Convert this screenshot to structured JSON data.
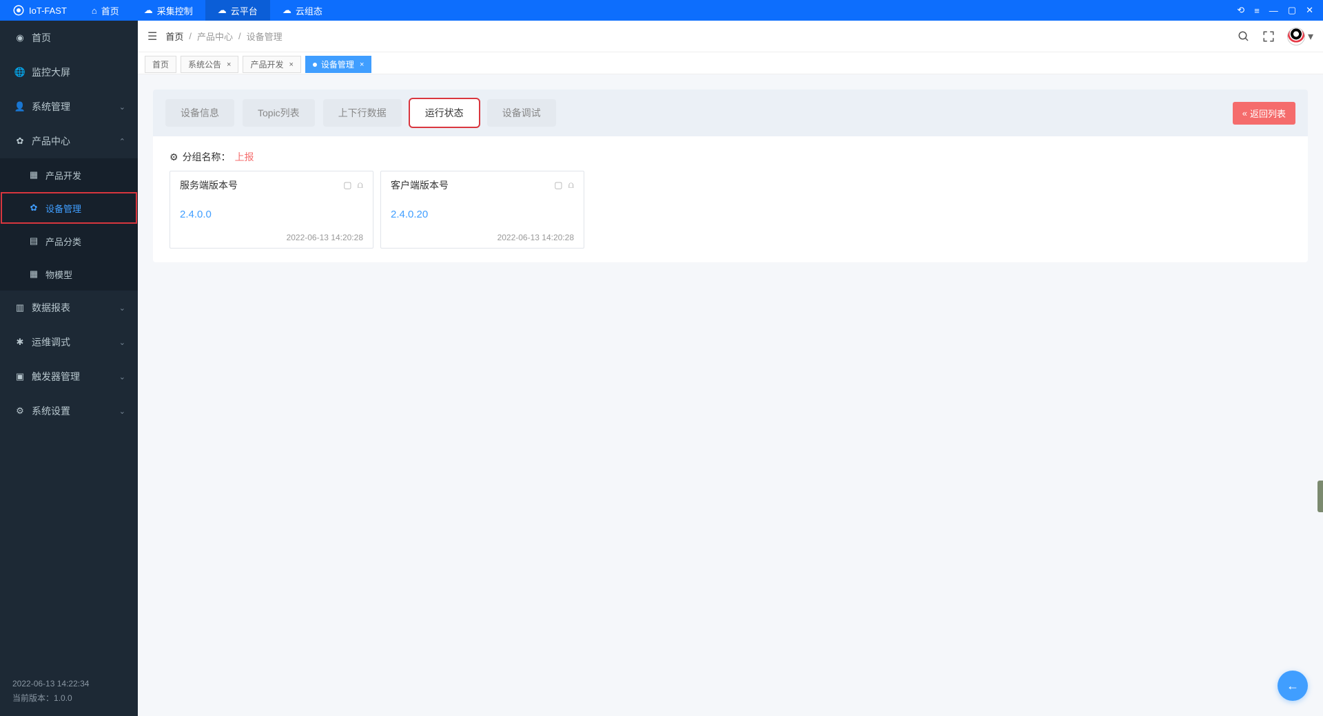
{
  "app": {
    "name": "IoT-FAST"
  },
  "titlebar_nav": [
    {
      "label": "首页",
      "icon": "home"
    },
    {
      "label": "采集控制",
      "icon": "cloud"
    },
    {
      "label": "云平台",
      "icon": "cloud-platform",
      "active": true
    },
    {
      "label": "云组态",
      "icon": "cloud-config"
    }
  ],
  "window_controls": {
    "refresh": "⟲",
    "menu": "≡",
    "min": "—",
    "max": "▢",
    "close": "✕"
  },
  "sidebar": {
    "items": [
      {
        "label": "首页",
        "icon": "dashboard"
      },
      {
        "label": "监控大屏",
        "icon": "globe"
      },
      {
        "label": "系统管理",
        "icon": "user",
        "expandable": true,
        "expanded": false
      },
      {
        "label": "产品中心",
        "icon": "gear",
        "expandable": true,
        "expanded": true,
        "children": [
          {
            "label": "产品开发",
            "icon": "box"
          },
          {
            "label": "设备管理",
            "icon": "gear",
            "active": true,
            "highlight": true
          },
          {
            "label": "产品分类",
            "icon": "list"
          },
          {
            "label": "物模型",
            "icon": "grid"
          }
        ]
      },
      {
        "label": "数据报表",
        "icon": "chart",
        "expandable": true
      },
      {
        "label": "运维调式",
        "icon": "bug",
        "expandable": true
      },
      {
        "label": "触发器管理",
        "icon": "trigger",
        "expandable": true
      },
      {
        "label": "系统设置",
        "icon": "cog",
        "expandable": true
      }
    ],
    "footer": {
      "time": "2022-06-13 14:22:34",
      "version_label": "当前版本：",
      "version": "1.0.0"
    }
  },
  "breadcrumb": [
    "首页",
    "产品中心",
    "设备管理"
  ],
  "open_tabs": [
    {
      "label": "首页",
      "closable": false
    },
    {
      "label": "系统公告",
      "closable": true
    },
    {
      "label": "产品开发",
      "closable": true
    },
    {
      "label": "设备管理",
      "closable": true,
      "active": true
    }
  ],
  "seg_tabs": [
    {
      "label": "设备信息"
    },
    {
      "label": "Topic列表"
    },
    {
      "label": "上下行数据"
    },
    {
      "label": "运行状态",
      "active": true,
      "highlight": true
    },
    {
      "label": "设备调试"
    }
  ],
  "back_button": "返回列表",
  "group": {
    "label": "分组名称：",
    "value": "上报"
  },
  "cards": [
    {
      "title": "服务端版本号",
      "value": "2.4.0.0",
      "time": "2022-06-13 14:20:28"
    },
    {
      "title": "客户端版本号",
      "value": "2.4.0.20",
      "time": "2022-06-13 14:20:28"
    }
  ]
}
